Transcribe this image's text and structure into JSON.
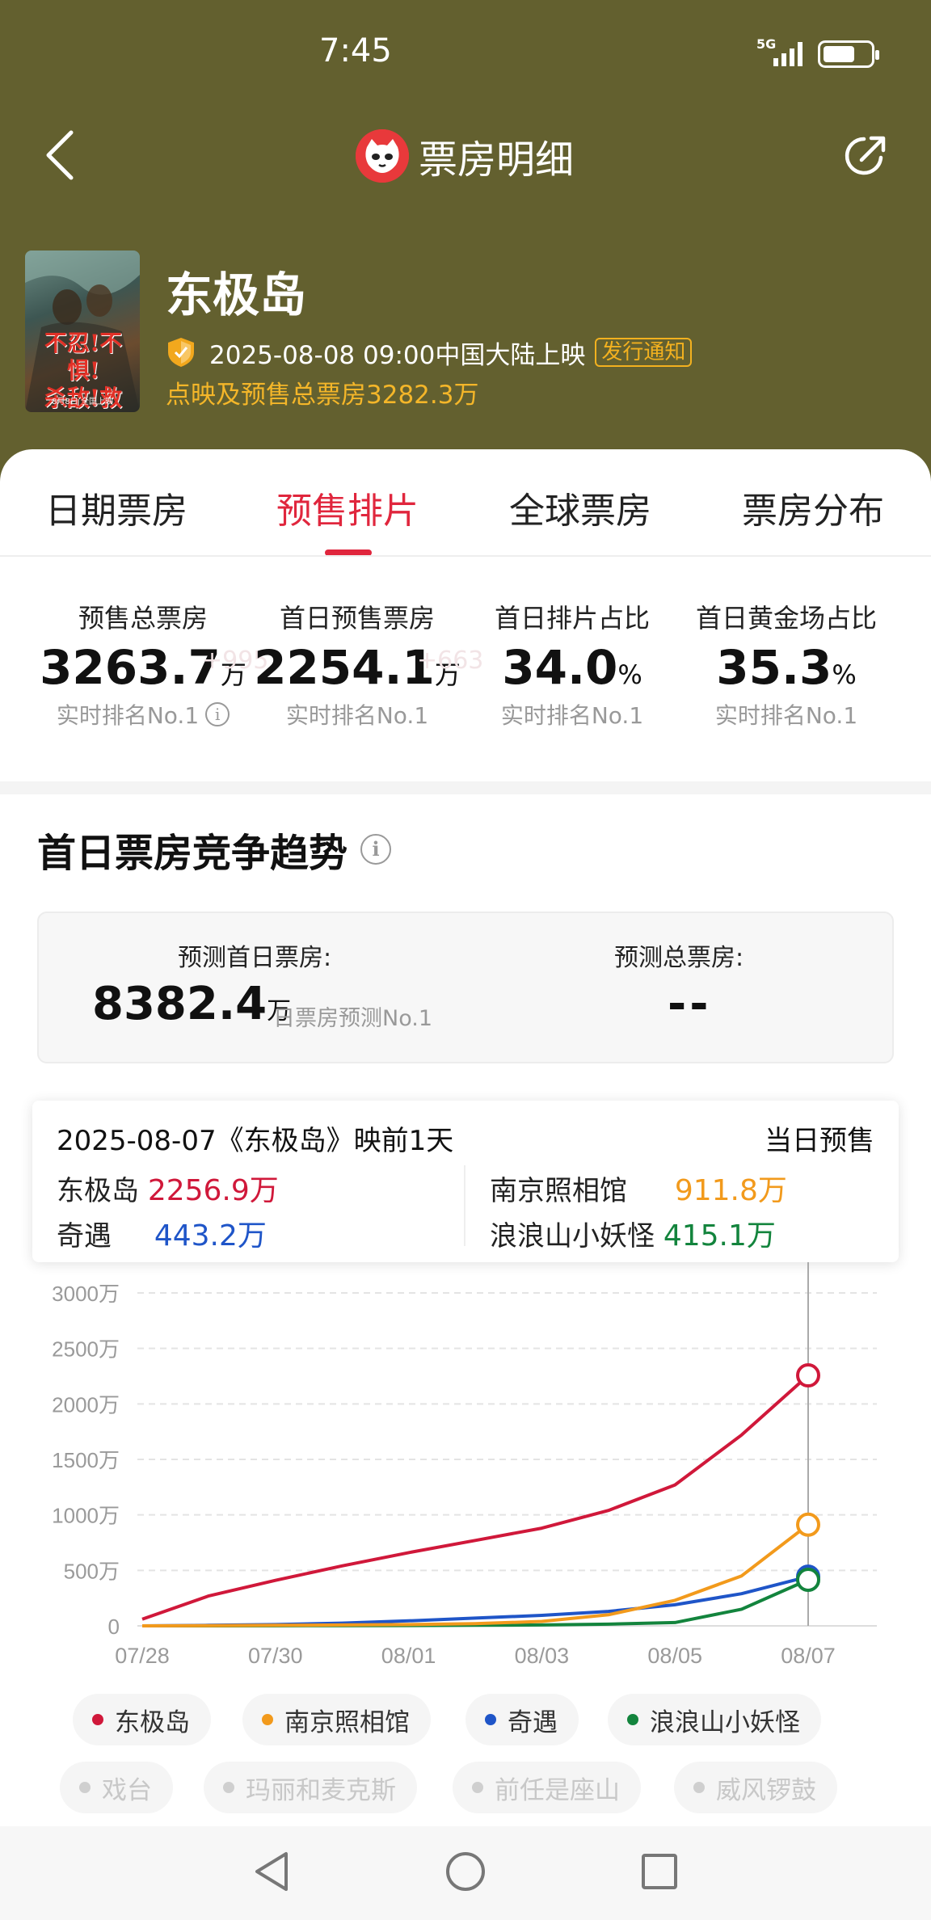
{
  "status": {
    "time": "7:45",
    "network": "5G"
  },
  "header": {
    "title": "票房明细"
  },
  "movie": {
    "poster_text": "不忍!不惧!\n杀敌!救人!",
    "poster_sub": "8月8日 全国上映",
    "title": "东极岛",
    "release": "2025-08-08 09:00中国大陆上映",
    "notice_badge": "发行通知",
    "presale_total": "点映及预售总票房3282.3万"
  },
  "tabs": [
    {
      "label": "日期票房"
    },
    {
      "label": "预售排片"
    },
    {
      "label": "全球票房"
    },
    {
      "label": "票房分布"
    }
  ],
  "stats": [
    {
      "label": "预售总票房",
      "value": "3263.7",
      "unit": "万",
      "ghost": "+995",
      "rank": "实时排名No.1"
    },
    {
      "label": "首日预售票房",
      "value": "2254.1",
      "unit": "万",
      "ghost": "+663",
      "rank": "实时排名No.1"
    },
    {
      "label": "首日排片占比",
      "value": "34.0",
      "unit": "%",
      "rank": "实时排名No.1"
    },
    {
      "label": "首日黄金场占比",
      "value": "35.3",
      "unit": "%",
      "rank": "实时排名No.1"
    }
  ],
  "section": {
    "title": "首日票房竞争趋势"
  },
  "forecast": {
    "first_day_label": "预测首日票房:",
    "first_day_value": "8382.4",
    "first_day_unit": "万",
    "first_day_rank": "日票房预测No.1",
    "total_label": "预测总票房:",
    "total_value": "--"
  },
  "tooltip": {
    "header": "2025-08-07《东极岛》映前1天",
    "mode": "当日预售",
    "rows": [
      {
        "name": "东极岛",
        "value": "2256.9万"
      },
      {
        "name": "奇遇",
        "value": "443.2万"
      },
      {
        "name": "南京照相馆",
        "value": "911.8万"
      },
      {
        "name": "浪浪山小妖怪",
        "value": "415.1万"
      }
    ]
  },
  "chart_data": {
    "type": "line",
    "x": [
      "07/28",
      "07/29",
      "07/30",
      "07/31",
      "08/01",
      "08/02",
      "08/03",
      "08/04",
      "08/05",
      "08/06",
      "08/07"
    ],
    "x_tick_labels": [
      "07/28",
      "07/30",
      "08/01",
      "08/03",
      "08/05",
      "08/07"
    ],
    "y_tick_labels": [
      "0",
      "500万",
      "1000万",
      "1500万",
      "2000万",
      "2500万",
      "3000万"
    ],
    "ylim": [
      0,
      3000
    ],
    "y_unit": "万",
    "grid": true,
    "highlight_x": "08/07",
    "series": [
      {
        "name": "东极岛",
        "color": "#d0183a",
        "values": [
          60,
          270,
          410,
          540,
          660,
          770,
          880,
          1040,
          1270,
          1720,
          2256.9
        ]
      },
      {
        "name": "南京照相馆",
        "color": "#f29a1c",
        "values": [
          0,
          2,
          5,
          8,
          12,
          20,
          40,
          100,
          230,
          450,
          911.8
        ]
      },
      {
        "name": "奇遇",
        "color": "#1f55c8",
        "values": [
          0,
          5,
          12,
          25,
          45,
          70,
          95,
          130,
          190,
          290,
          443.2
        ]
      },
      {
        "name": "浪浪山小妖怪",
        "color": "#13843d",
        "values": [
          0,
          0,
          1,
          2,
          3,
          5,
          8,
          15,
          30,
          150,
          415.1
        ]
      }
    ]
  },
  "legend": {
    "active": [
      {
        "name": "东极岛",
        "color": "#d0183a"
      },
      {
        "name": "南京照相馆",
        "color": "#f29a1c"
      },
      {
        "name": "奇遇",
        "color": "#1f55c8"
      },
      {
        "name": "浪浪山小妖怪",
        "color": "#13843d"
      }
    ],
    "inactive": [
      {
        "name": "戏台"
      },
      {
        "name": "玛丽和麦克斯"
      },
      {
        "name": "前任是座山"
      },
      {
        "name": "威风锣鼓"
      }
    ]
  }
}
